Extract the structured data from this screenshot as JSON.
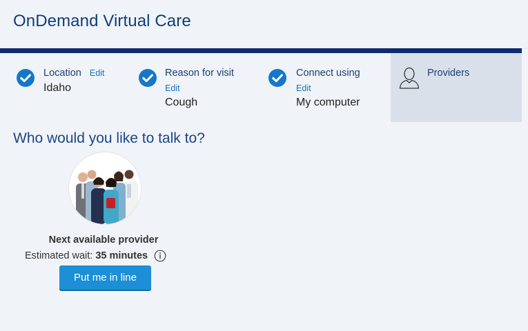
{
  "app": {
    "title": "OnDemand Virtual Care"
  },
  "steps": [
    {
      "label": "Location",
      "edit": "Edit",
      "value": "Idaho",
      "status": "complete"
    },
    {
      "label": "Reason for visit",
      "edit": "Edit",
      "value": "Cough",
      "status": "complete"
    },
    {
      "label": "Connect using",
      "edit": "Edit",
      "value": "My computer",
      "status": "complete"
    },
    {
      "label": "Providers",
      "status": "active"
    }
  ],
  "main": {
    "question": "Who would you like to talk to?",
    "provider": {
      "title": "Next available provider",
      "wait_label": "Estimated wait:",
      "wait_value": "35 minutes",
      "button": "Put me in line"
    }
  },
  "icons": {
    "check": "check-circle-icon",
    "user": "user-outline-icon",
    "info": "info-icon"
  },
  "colors": {
    "brand_navy": "#0d2c6f",
    "title_blue": "#0f3d7a",
    "check_blue": "#1677c9",
    "button_blue": "#1c8fd6",
    "active_step_bg": "#d9e0ea"
  }
}
